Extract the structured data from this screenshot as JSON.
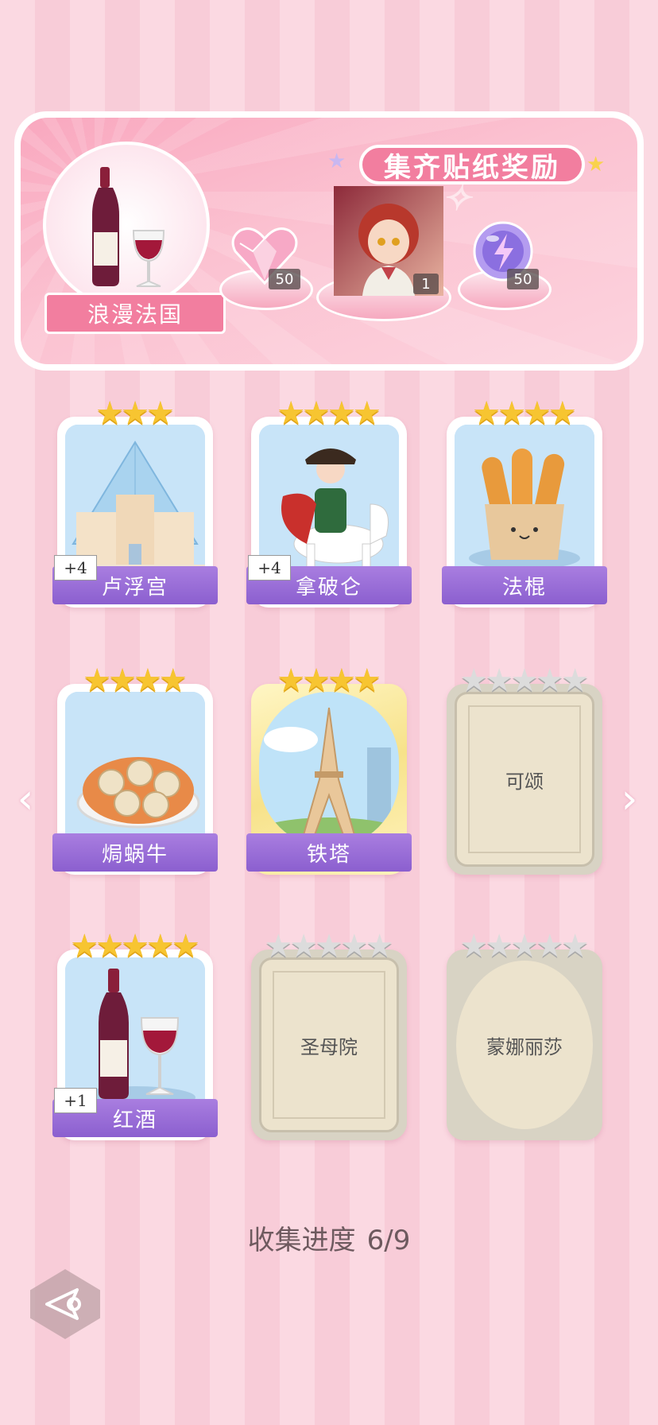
{
  "banner": {
    "title": "集齐贴纸奖励",
    "theme_name": "浪漫法国",
    "rewards": [
      {
        "icon": "pink-heart-gem-icon",
        "count": "50"
      },
      {
        "icon": "character-portrait",
        "count": "1"
      },
      {
        "icon": "purple-energy-orb-icon",
        "count": "50"
      }
    ]
  },
  "cards": [
    {
      "name": "卢浮宫",
      "stars": 3,
      "max_stars": 3,
      "collected": true,
      "extra": "+4",
      "art": "louvre"
    },
    {
      "name": "拿破仑",
      "stars": 4,
      "max_stars": 4,
      "collected": true,
      "extra": "+4",
      "art": "napoleon"
    },
    {
      "name": "法棍",
      "stars": 4,
      "max_stars": 4,
      "collected": true,
      "extra": "",
      "art": "baguette"
    },
    {
      "name": "焗蜗牛",
      "stars": 4,
      "max_stars": 4,
      "collected": true,
      "extra": "",
      "art": "escargot"
    },
    {
      "name": "铁塔",
      "stars": 4,
      "max_stars": 4,
      "collected": true,
      "extra": "",
      "art": "eiffel",
      "gold": true
    },
    {
      "name": "可颂",
      "stars": 0,
      "max_stars": 5,
      "collected": false
    },
    {
      "name": "红酒",
      "stars": 5,
      "max_stars": 5,
      "collected": true,
      "extra": "+1",
      "art": "wine"
    },
    {
      "name": "圣母院",
      "stars": 0,
      "max_stars": 5,
      "collected": false
    },
    {
      "name": "蒙娜丽莎",
      "stars": 0,
      "max_stars": 5,
      "collected": false,
      "gold": true
    }
  ],
  "progress": {
    "label": "收集进度",
    "value": "6/9"
  },
  "colors": {
    "accent_pink": "#f27e9f",
    "label_purple": "#8b5fcf",
    "star_gold": "#f7c531"
  }
}
